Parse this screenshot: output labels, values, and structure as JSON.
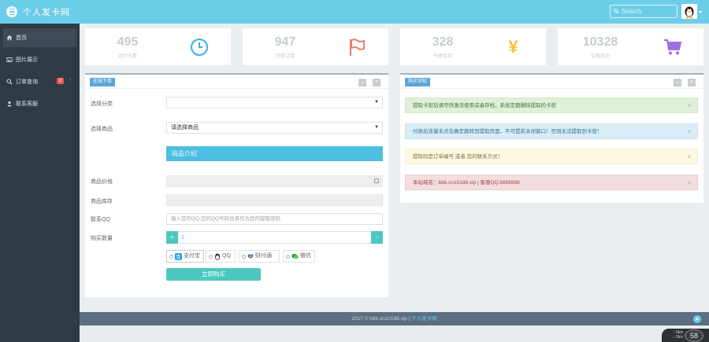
{
  "header": {
    "title": "个人发卡网",
    "search_placeholder": "Search"
  },
  "sidebar": {
    "items": [
      {
        "label": "首页",
        "icon": "home-icon"
      },
      {
        "label": "图片展示",
        "icon": "image-icon"
      },
      {
        "label": "订单查询",
        "icon": "search-icon",
        "badge": "2"
      },
      {
        "label": "联系客服",
        "icon": "user-icon"
      }
    ]
  },
  "stats": [
    {
      "value": "495",
      "label": "运行天数",
      "icon": "clock-icon",
      "color": "#4bb3de"
    },
    {
      "value": "947",
      "label": "历史订单",
      "icon": "flag-icon",
      "color": "#ef7b6a"
    },
    {
      "value": "328",
      "label": "卡密库存",
      "icon": "yen-icon",
      "color": "#f5c43d"
    },
    {
      "value": "10328",
      "label": "交易成功",
      "icon": "cart-icon",
      "color": "#a06ee0"
    }
  ],
  "order_panel": {
    "tag": "在线下单",
    "labels": {
      "category": "选择分类",
      "product": "选择商品",
      "price": "商品价格",
      "stock": "商品库存",
      "contact": "联系QQ",
      "quantity": "购买数量"
    },
    "category_value": "",
    "product_value": "请选择商品",
    "product_info_label": "商品介绍",
    "contact_placeholder": "输入您的QQ,您的QQ号码也将作为您的提取密码",
    "quantity_value": "1",
    "stepper_minus": "+",
    "stepper_plus": "-",
    "payment_options": [
      "支付宝",
      "QQ",
      "财付通",
      "微信"
    ],
    "buy_label": "立即购买"
  },
  "notice_panel": {
    "tag": "购买须知",
    "notices": [
      {
        "text": "提取卡密后请尽快激活使用或者存档，系统定期删除提取的卡密",
        "type": "success"
      },
      {
        "text": "付款后该量未点击确定跳转到提取页面，不可提前关闭窗口！否则无法提取到卡密！",
        "type": "info"
      },
      {
        "text": "提取码是订单编号 或者 您的联系方式！",
        "type": "warning"
      },
      {
        "text": "本站域名：bbb.sn10188.vip | 客服QQ:8888888",
        "type": "danger"
      }
    ]
  },
  "footer": {
    "text": "2017 © bbb.sn10188.vip",
    "separator": "|",
    "link": "个人发卡网"
  },
  "speed_widget": {
    "up": "0k/s",
    "down": "0k/s",
    "percent": "58"
  }
}
